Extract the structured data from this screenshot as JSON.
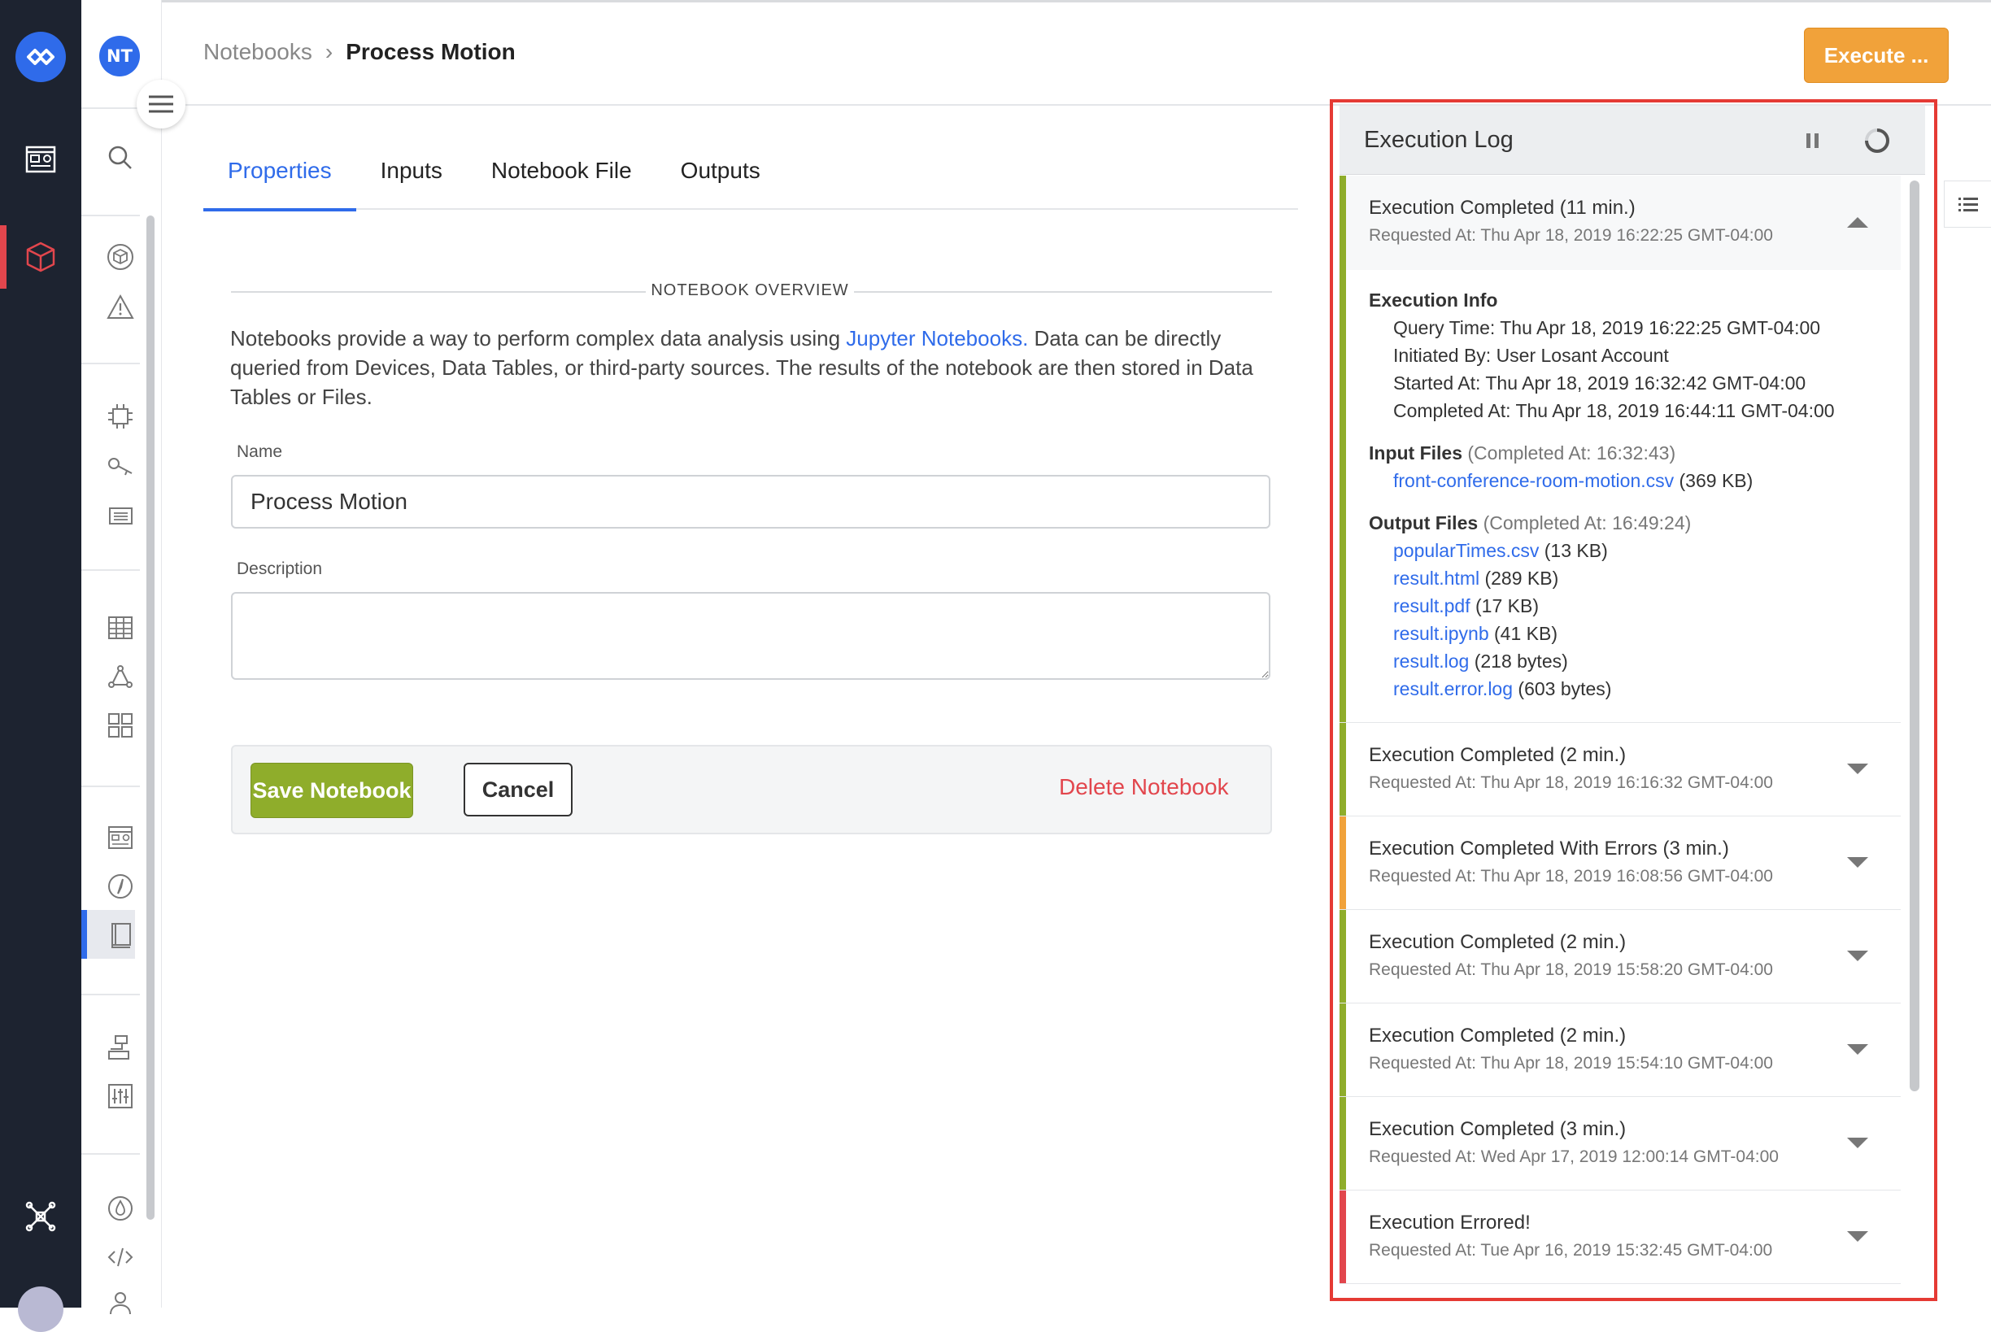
{
  "rail": {
    "logo_icon": "losant-logo-icon",
    "items": [
      "dashboard-icon",
      "application-cube-icon",
      "hub-icon"
    ],
    "active_color": "#e2464d"
  },
  "sidebar": {
    "avatar_initials": "NT",
    "icons": [
      "search-icon",
      "cube-icon",
      "warning-icon",
      "chip-icon",
      "key-icon",
      "news-icon",
      "table-icon",
      "workflow-icon",
      "puzzle-icon",
      "dashboard-icon",
      "compass-icon",
      "notebook-icon",
      "edge-icon",
      "sliders-icon",
      "droplet-icon",
      "code-icon",
      "user-icon"
    ],
    "active_item": "notebook-icon"
  },
  "breadcrumb": {
    "parent": "Notebooks",
    "separator": "›",
    "current": "Process Motion"
  },
  "header": {
    "execute_label": "Execute ..."
  },
  "tabs": [
    {
      "label": "Properties",
      "active": true
    },
    {
      "label": "Inputs",
      "active": false
    },
    {
      "label": "Notebook File",
      "active": false
    },
    {
      "label": "Outputs",
      "active": false
    }
  ],
  "overview": {
    "title": "NOTEBOOK OVERVIEW",
    "text_before": "Notebooks provide a way to perform complex data analysis using ",
    "link": "Jupyter Notebooks.",
    "text_after": " Data can be directly queried from Devices, Data Tables, or third-party sources. The results of the notebook are then stored in Data Tables or Files."
  },
  "form": {
    "name_label": "Name",
    "name_value": "Process Motion",
    "description_label": "Description",
    "description_value": "",
    "save_label": "Save Notebook",
    "cancel_label": "Cancel",
    "delete_label": "Delete Notebook"
  },
  "log": {
    "title": "Execution Log",
    "pause_icon": "pause-icon",
    "refresh_icon": "refresh-icon",
    "entries": [
      {
        "title": "Execution Completed (11 min.)",
        "requested": "Requested At: Thu Apr 18, 2019 16:22:25 GMT-04:00",
        "status_color": "#8fad2b",
        "expanded": true,
        "info_heading": "Execution Info",
        "info": [
          "Query Time: Thu Apr 18, 2019 16:22:25 GMT-04:00",
          "Initiated By: User Losant Account",
          "Started At: Thu Apr 18, 2019 16:32:42 GMT-04:00",
          "Completed At: Thu Apr 18, 2019 16:44:11 GMT-04:00"
        ],
        "input_heading": "Input Files",
        "input_meta": "(Completed At: 16:32:43)",
        "inputs": [
          {
            "name": "front-conference-room-motion.csv",
            "size": "(369 KB)"
          }
        ],
        "output_heading": "Output Files",
        "output_meta": "(Completed At: 16:49:24)",
        "outputs": [
          {
            "name": "popularTimes.csv",
            "size": "(13 KB)"
          },
          {
            "name": "result.html",
            "size": "(289 KB)"
          },
          {
            "name": "result.pdf",
            "size": "(17 KB)"
          },
          {
            "name": "result.ipynb",
            "size": "(41 KB)"
          },
          {
            "name": "result.log",
            "size": "(218 bytes)"
          },
          {
            "name": "result.error.log",
            "size": "(603 bytes)"
          }
        ]
      },
      {
        "title": "Execution Completed (2 min.)",
        "requested": "Requested At: Thu Apr 18, 2019 16:16:32 GMT-04:00",
        "status_color": "#8fad2b",
        "expanded": false
      },
      {
        "title": "Execution Completed With Errors (3 min.)",
        "requested": "Requested At: Thu Apr 18, 2019 16:08:56 GMT-04:00",
        "status_color": "#f1a23a",
        "expanded": false
      },
      {
        "title": "Execution Completed (2 min.)",
        "requested": "Requested At: Thu Apr 18, 2019 15:58:20 GMT-04:00",
        "status_color": "#8fad2b",
        "expanded": false
      },
      {
        "title": "Execution Completed (2 min.)",
        "requested": "Requested At: Thu Apr 18, 2019 15:54:10 GMT-04:00",
        "status_color": "#8fad2b",
        "expanded": false
      },
      {
        "title": "Execution Completed (3 min.)",
        "requested": "Requested At: Wed Apr 17, 2019 12:00:14 GMT-04:00",
        "status_color": "#8fad2b",
        "expanded": false
      },
      {
        "title": "Execution Errored!",
        "requested": "Requested At: Tue Apr 16, 2019 15:32:45 GMT-04:00",
        "status_color": "#e2464d",
        "expanded": false
      }
    ]
  },
  "colors": {
    "accent": "#2f6bea",
    "success": "#8fad2b",
    "warning": "#f1a23a",
    "danger": "#e2464d"
  }
}
